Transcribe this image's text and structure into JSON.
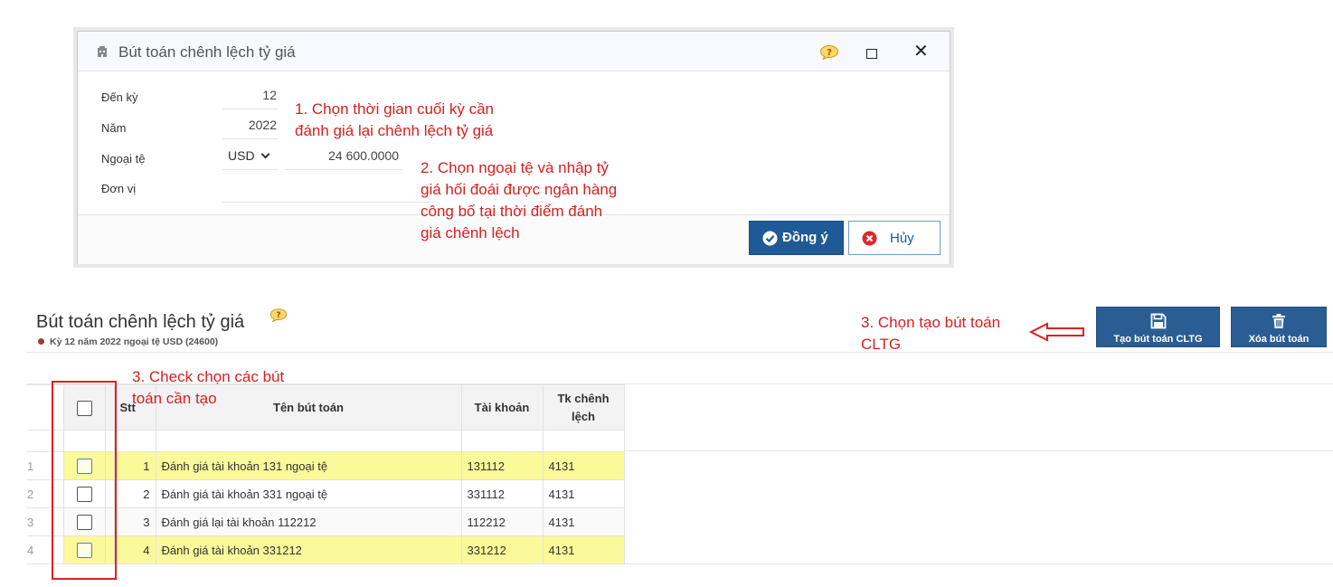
{
  "dialog": {
    "title": "Bút toán chênh lệch tỷ giá",
    "fields": {
      "den_ky": {
        "label": "Đến kỳ",
        "value": "12"
      },
      "nam": {
        "label": "Năm",
        "value": "2022"
      },
      "ngoai_te": {
        "label": "Ngoại tệ",
        "currency": "USD",
        "rate": "24 600.0000"
      },
      "don_vi": {
        "label": "Đơn vị",
        "value": ""
      }
    },
    "ok_label": "Đồng ý",
    "cancel_label": "Hủy"
  },
  "notes": {
    "n1_line1": "1. Chọn thời gian cuối kỳ cần",
    "n1_line2": "đánh giá lại chênh lệch tỷ giá",
    "n2_line1": "2. Chọn ngoại tệ và nhập tỷ",
    "n2_line2": "giá hối đoái được ngân hàng",
    "n2_line3": "công bố tại thời điểm đánh",
    "n2_line4": "giá chênh lệch",
    "n3a_line1": "3. Chọn tạo bút toán",
    "n3a_line2": "CLTG",
    "n3b_line1": "3. Check chọn các bút",
    "n3b_line2": "toán cần tạo"
  },
  "page": {
    "title": "Bút toán chênh lệch tỷ giá",
    "subtitle": "Kỳ 12 năm 2022 ngoại tệ USD (24600)"
  },
  "toolbar": {
    "create_label": "Tạo bút toán CLTG",
    "delete_label": "Xóa bút toán"
  },
  "table": {
    "headers": {
      "stt": "Stt",
      "ten": "Tên bút toán",
      "tk": "Tài khoản",
      "tkcl_1": "Tk chênh",
      "tkcl_2": "lệch"
    },
    "rows": [
      {
        "rn": "1",
        "stt": "1",
        "ten": "Đánh giá tài khoản 131 ngoại tệ",
        "tk": "131112",
        "tkcl": "4131"
      },
      {
        "rn": "2",
        "stt": "2",
        "ten": "Đánh giá tài khoản 331 ngoại tệ",
        "tk": "331112",
        "tkcl": "4131"
      },
      {
        "rn": "3",
        "stt": "3",
        "ten": "Đánh giá lại tài khoản 112212",
        "tk": "112212",
        "tkcl": "4131"
      },
      {
        "rn": "4",
        "stt": "4",
        "ten": "Đánh giá tài khoản 331212",
        "tk": "331212",
        "tkcl": "4131"
      }
    ]
  },
  "colors": {
    "primary": "#1f5a96",
    "annotation": "#d62020",
    "highlight_row": "#fbfa9a"
  },
  "icons": [
    "building-icon",
    "help-icon",
    "maximize-icon",
    "close-icon",
    "check-circle-icon",
    "cancel-circle-icon",
    "save-icon",
    "trash-icon",
    "arrow-left-icon"
  ]
}
